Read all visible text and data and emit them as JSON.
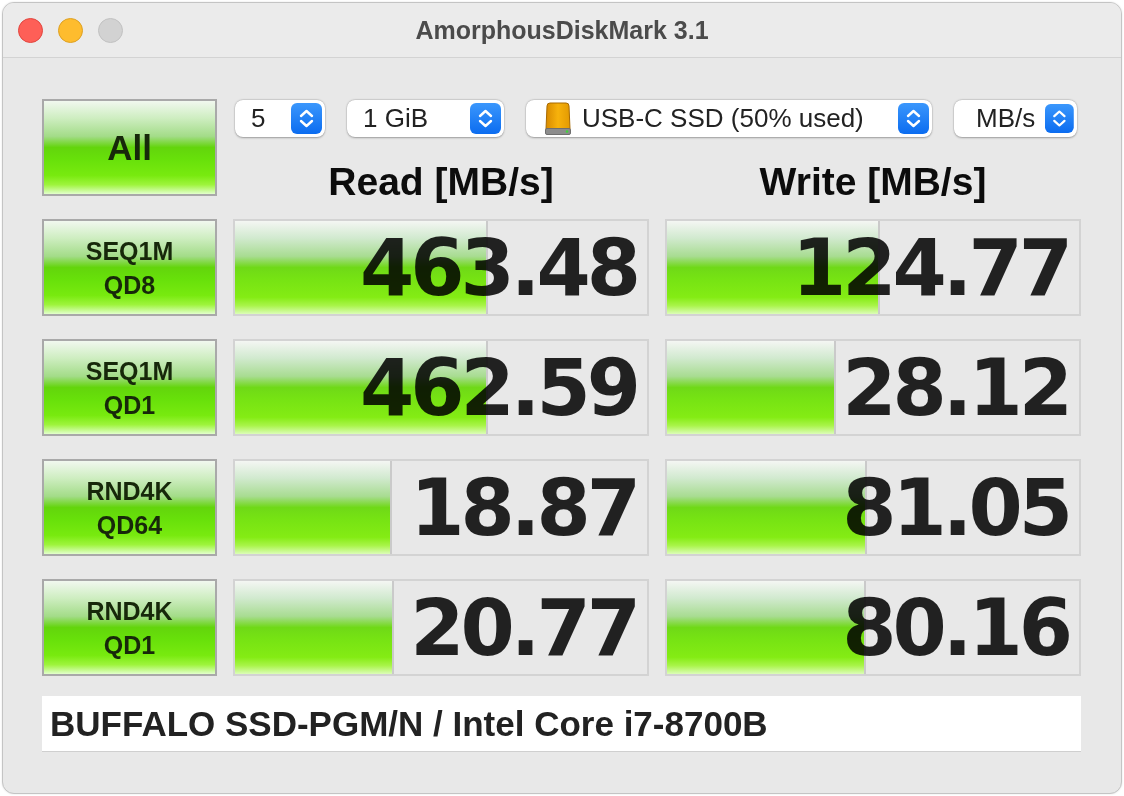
{
  "window": {
    "title": "AmorphousDiskMark 3.1",
    "controls": [
      {
        "kind": "close",
        "disabled": false
      },
      {
        "kind": "minimize",
        "disabled": false
      },
      {
        "kind": "zoom",
        "disabled": true
      }
    ]
  },
  "all_button": {
    "label": "All"
  },
  "settings": [
    {
      "kind": "count",
      "value": "5"
    },
    {
      "kind": "size",
      "value": "1 GiB"
    },
    {
      "kind": "drive",
      "value": "USB-C SSD (50% used)"
    },
    {
      "kind": "unit",
      "value": "MB/s"
    }
  ],
  "columns": [
    {
      "header": "Read [MB/s]"
    },
    {
      "header": "Write [MB/s]"
    }
  ],
  "tests": [
    {
      "label": "SEQ1M QD8",
      "results": [
        {
          "reading": "463.48",
          "level": 0.614
        },
        {
          "reading": "124.77",
          "level": 0.517
        }
      ]
    },
    {
      "label": "SEQ1M QD1",
      "results": [
        {
          "reading": "462.59",
          "level": 0.614
        },
        {
          "reading": "28.12",
          "level": 0.41
        }
      ]
    },
    {
      "label": "RND4K QD64",
      "results": [
        {
          "reading": "18.87",
          "level": 0.38
        },
        {
          "reading": "81.05",
          "level": 0.485
        }
      ]
    },
    {
      "label": "RND4K QD1",
      "results": [
        {
          "reading": "20.77",
          "level": 0.387
        },
        {
          "reading": "80.16",
          "level": 0.484
        }
      ]
    }
  ],
  "comment": {
    "value": "BUFFALO SSD-PGM/N / Intel Core i7-8700B"
  }
}
